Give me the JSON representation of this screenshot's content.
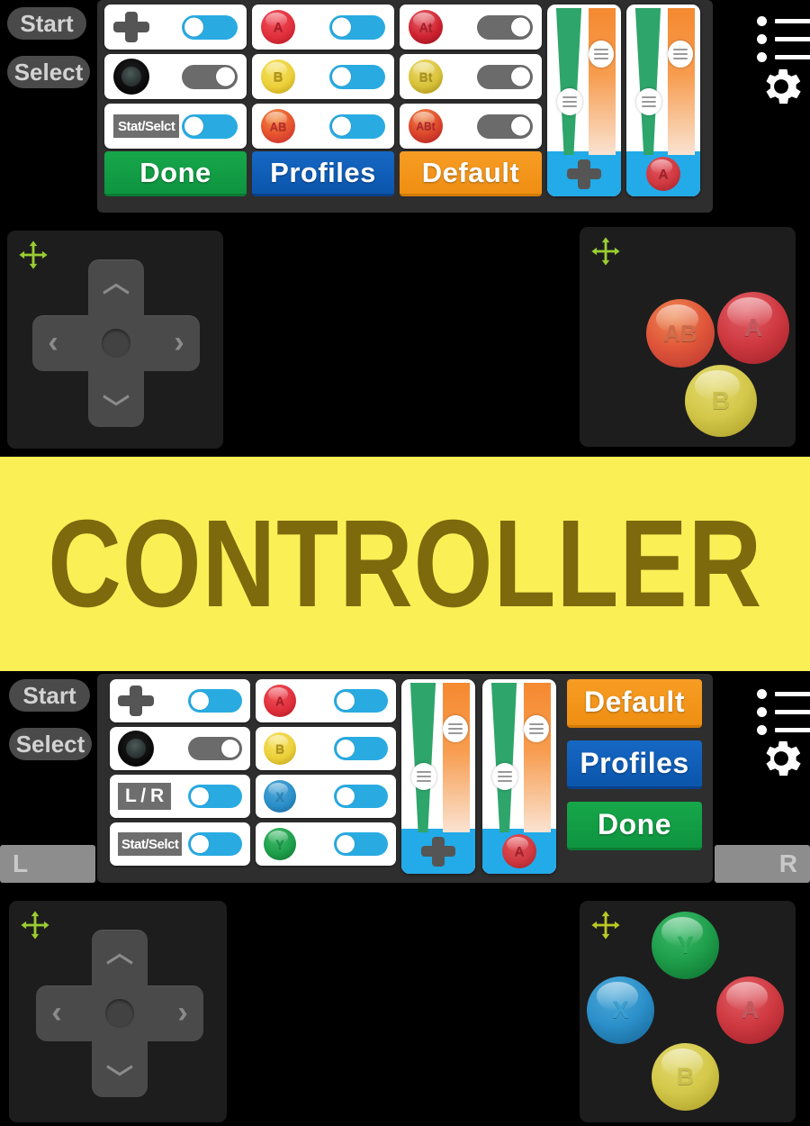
{
  "banner": {
    "title": "CONTROLLER",
    "bg_color": "#FAF056",
    "text_color": "#7d6a0d"
  },
  "colors": {
    "toggle_on": "#29ABE2",
    "toggle_off": "#6b6b6b",
    "done": "#0e9440",
    "profiles": "#0b55ac",
    "default": "#ef8f12",
    "slider_green": "#2ea56a",
    "slider_orange": "#f58a31",
    "slider_foot": "#23AAE8",
    "panel": "#2e2e2e",
    "zone": "#1d1d1d",
    "move_icon": "#9ACD32"
  },
  "top_editor": {
    "overlay_buttons": [
      {
        "label": "Start",
        "name": "start-button"
      },
      {
        "label": "Select",
        "name": "select-button"
      }
    ],
    "icons": [
      {
        "name": "list-menu-icon",
        "glyph": "hamburger-list"
      },
      {
        "name": "gear-icon",
        "glyph": "gear"
      }
    ],
    "column1": [
      {
        "id": "dpad",
        "kind": "dpad-glyph",
        "label": "",
        "toggle": "on"
      },
      {
        "id": "stick",
        "kind": "stick-glyph",
        "label": "",
        "toggle": "off"
      },
      {
        "id": "statselct",
        "kind": "pill",
        "label": "Stat/Selct",
        "toggle": "on"
      }
    ],
    "column2": [
      {
        "id": "a",
        "kind": "round",
        "label": "A",
        "color": "#e02f3c",
        "toggle": "on"
      },
      {
        "id": "b",
        "kind": "round",
        "label": "B",
        "color": "#ecd03a",
        "toggle": "on"
      },
      {
        "id": "ab",
        "kind": "round",
        "label": "AB",
        "color": "#e8562e",
        "toggle": "on"
      }
    ],
    "column3": [
      {
        "id": "at",
        "kind": "round",
        "label": "At",
        "color": "#cf2230",
        "toggle": "off"
      },
      {
        "id": "bt",
        "kind": "round",
        "label": "Bt",
        "color": "#d8c23a",
        "toggle": "off"
      },
      {
        "id": "abt",
        "kind": "round",
        "label": "ABt",
        "color": "#df4a2c",
        "toggle": "off"
      }
    ],
    "sliders": [
      {
        "id": "dpad-size-opacity",
        "foot_label": "",
        "foot_kind": "dpad",
        "size_pct": 62,
        "opacity_pct": 26
      },
      {
        "id": "a-size-opacity",
        "foot_label": "A",
        "foot_kind": "round",
        "size_pct": 58,
        "opacity_pct": 26
      }
    ],
    "actions": [
      {
        "id": "done",
        "label": "Done",
        "style": "btn-done"
      },
      {
        "id": "profiles",
        "label": "Profiles",
        "style": "btn-profiles"
      },
      {
        "id": "default",
        "label": "Default",
        "style": "btn-default"
      }
    ]
  },
  "top_preview": {
    "dpad_zone": {
      "name": "dpad-zone",
      "move_handle": "move-handle-icon"
    },
    "button_zone": {
      "name": "action-button-zone",
      "move_handle": "move-handle-icon",
      "buttons": [
        {
          "label": "AB",
          "color": "#e0573a"
        },
        {
          "label": "A",
          "color": "#cf3940"
        },
        {
          "label": "B",
          "color": "#d4c84a"
        }
      ]
    }
  },
  "bottom_editor": {
    "overlay_buttons": [
      {
        "label": "Start",
        "name": "start-button"
      },
      {
        "label": "Select",
        "name": "select-button"
      }
    ],
    "shoulder_buttons": [
      {
        "label": "L",
        "name": "shoulder-l-button"
      },
      {
        "label": "R",
        "name": "shoulder-r-button"
      }
    ],
    "icons": [
      {
        "name": "list-menu-icon",
        "glyph": "hamburger-list"
      },
      {
        "name": "gear-icon",
        "glyph": "gear"
      }
    ],
    "column1": [
      {
        "id": "dpad",
        "kind": "dpad-glyph",
        "label": "",
        "toggle": "on"
      },
      {
        "id": "stick",
        "kind": "stick-glyph",
        "label": "",
        "toggle": "off"
      },
      {
        "id": "lr",
        "kind": "pill",
        "label": "L / R",
        "toggle": "on"
      },
      {
        "id": "statselct",
        "kind": "pill",
        "label": "Stat/Selct",
        "toggle": "on"
      }
    ],
    "column2": [
      {
        "id": "a",
        "kind": "round",
        "label": "A",
        "color": "#e02f3c",
        "toggle": "on"
      },
      {
        "id": "b",
        "kind": "round",
        "label": "B",
        "color": "#ecd03a",
        "toggle": "on"
      },
      {
        "id": "x",
        "kind": "round",
        "label": "X",
        "color": "#2b8fc9",
        "toggle": "on"
      },
      {
        "id": "y",
        "kind": "round",
        "label": "Y",
        "color": "#1e9e4a",
        "toggle": "on"
      }
    ],
    "sliders": [
      {
        "id": "dpad-size-opacity",
        "foot_label": "",
        "foot_kind": "dpad",
        "size_pct": 62,
        "opacity_pct": 26
      },
      {
        "id": "a-size-opacity",
        "foot_label": "A",
        "foot_kind": "round",
        "size_pct": 58,
        "opacity_pct": 26
      }
    ],
    "actions": [
      {
        "id": "default",
        "label": "Default",
        "style": "btn-default"
      },
      {
        "id": "profiles",
        "label": "Profiles",
        "style": "btn-profiles"
      },
      {
        "id": "done",
        "label": "Done",
        "style": "btn-done"
      }
    ]
  },
  "bottom_preview": {
    "dpad_zone": {
      "name": "dpad-zone",
      "move_handle": "move-handle-icon"
    },
    "button_zone": {
      "name": "action-button-zone",
      "move_handle": "move-handle-icon",
      "buttons": [
        {
          "label": "Y",
          "color": "#1e9e4a"
        },
        {
          "label": "X",
          "color": "#2b8fc9"
        },
        {
          "label": "A",
          "color": "#cf3940"
        },
        {
          "label": "B",
          "color": "#d4c84a"
        }
      ]
    }
  }
}
